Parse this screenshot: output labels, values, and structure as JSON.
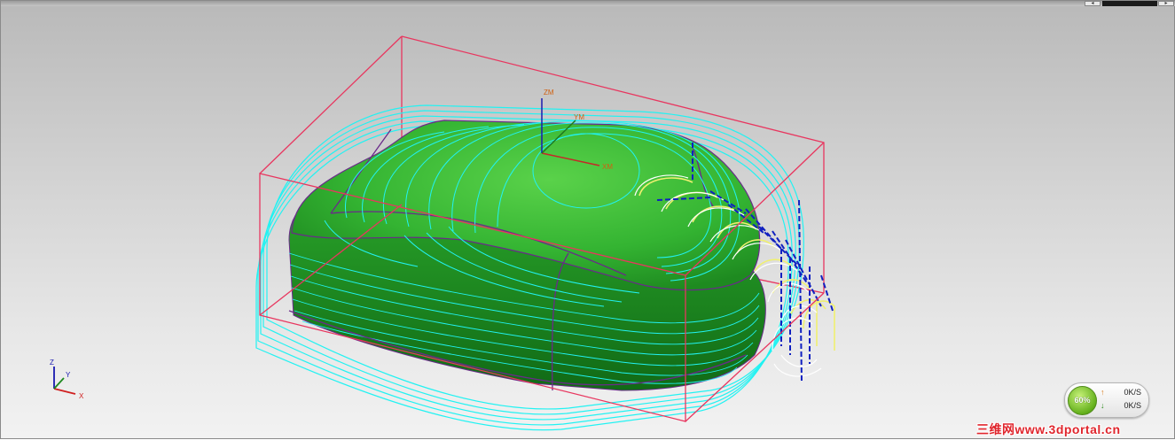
{
  "viewport": {
    "axis_labels": {
      "z": "ZM",
      "x": "XM",
      "y": "YM"
    },
    "triad": {
      "z": "Z",
      "y": "Y",
      "x": "X"
    }
  },
  "net_monitor": {
    "percent": "60%",
    "upload_speed": "0K/S",
    "download_speed": "0K/S"
  },
  "watermark": {
    "text": "三维网www.3dportal.cn"
  },
  "colors": {
    "part_green": "#3ec23a",
    "toolpath_cyan": "#22f2f2",
    "bounding_box": "#e8365f",
    "engage_yellow": "#f0f070",
    "rapid_blue": "#1020c0",
    "edge_purple": "#6a2a8a"
  }
}
